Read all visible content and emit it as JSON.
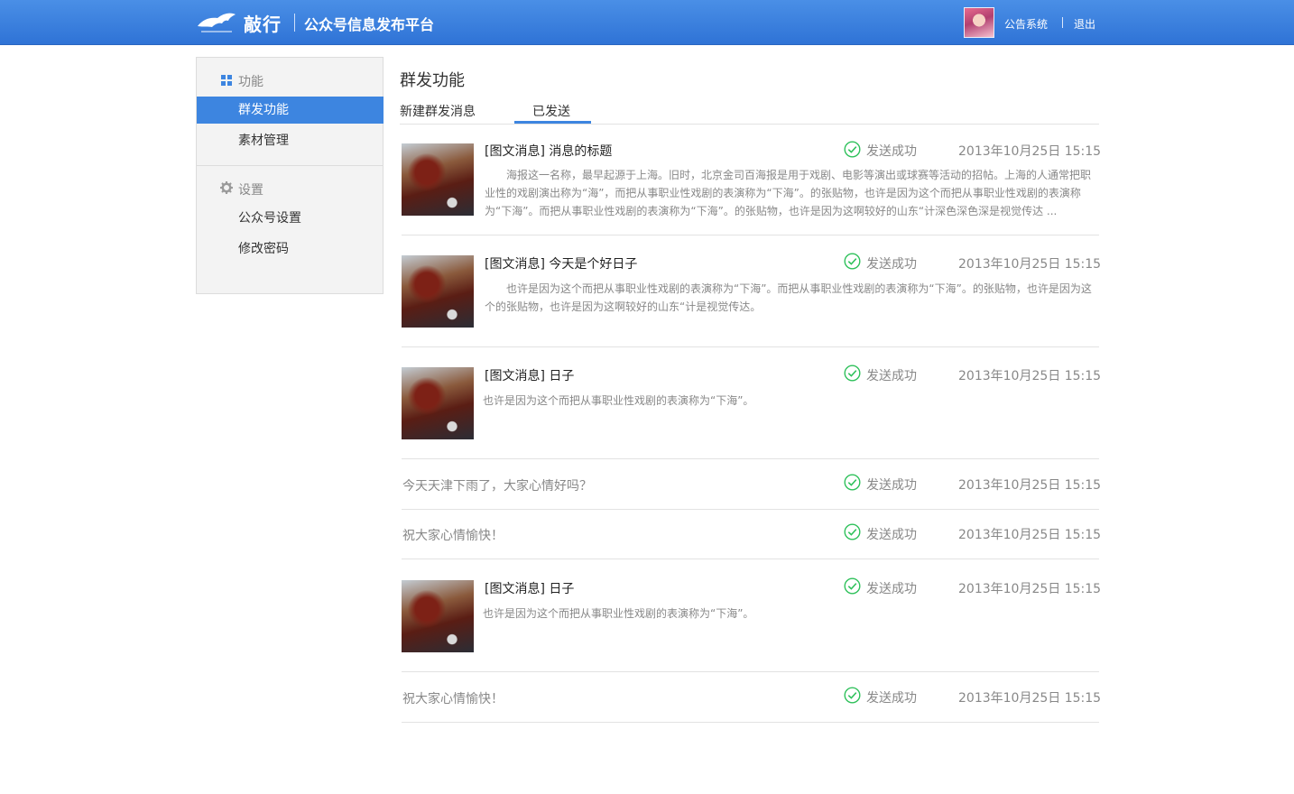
{
  "header": {
    "brand": "敲行",
    "platform": "公众号信息发布平台",
    "system_link": "公告系统",
    "logout_link": "退出",
    "accent_color": "#3d85e0"
  },
  "sidebar": {
    "section_function": "功能",
    "section_settings": "设置",
    "items": [
      {
        "label": "群发功能"
      },
      {
        "label": "素材管理"
      },
      {
        "label": "公众号设置"
      },
      {
        "label": "修改密码"
      }
    ]
  },
  "main": {
    "title": "群发功能",
    "tabs": [
      {
        "label": "新建群发消息"
      },
      {
        "label": "已发送"
      }
    ],
    "messages": [
      {
        "title": "[图文消息] 消息的标题",
        "status": "发送成功",
        "time": "2013年10月25日  15:15",
        "excerpt": "海报这一名称，最早起源于上海。旧时，北京金司百海报是用于戏剧、电影等演出或球赛等活动的招帖。上海的人通常把职业性的戏剧演出称为“海”，而把从事职业性戏剧的表演称为“下海”。的张贴物，也许是因为这个而把从事职业性戏剧的表演称为“下海”。而把从事职业性戏剧的表演称为“下海”。的张贴物，也许是因为这啊较好的山东“计深色深色深是视觉传达 ..."
      },
      {
        "title": "[图文消息] 今天是个好日子",
        "status": "发送成功",
        "time": "2013年10月25日  15:15",
        "excerpt": "也许是因为这个而把从事职业性戏剧的表演称为“下海”。而把从事职业性戏剧的表演称为“下海”。的张贴物，也许是因为这个的张贴物，也许是因为这啊较好的山东“计是视觉传达。"
      },
      {
        "title": "[图文消息] 日子",
        "status": "发送成功",
        "time": "2013年10月25日  15:15",
        "excerpt": "也许是因为这个而把从事职业性戏剧的表演称为“下海”。"
      },
      {
        "text": "今天天津下雨了，大家心情好吗？",
        "status": "发送成功",
        "time": "2013年10月25日  15:15"
      },
      {
        "text": "祝大家心情愉快！",
        "status": "发送成功",
        "time": "2013年10月25日  15:15"
      },
      {
        "title": "[图文消息] 日子",
        "status": "发送成功",
        "time": "2013年10月25日  15:15",
        "excerpt": "也许是因为这个而把从事职业性戏剧的表演称为“下海”。"
      },
      {
        "text": "祝大家心情愉快！",
        "status": "发送成功",
        "time": "2013年10月25日  15:15"
      }
    ]
  }
}
